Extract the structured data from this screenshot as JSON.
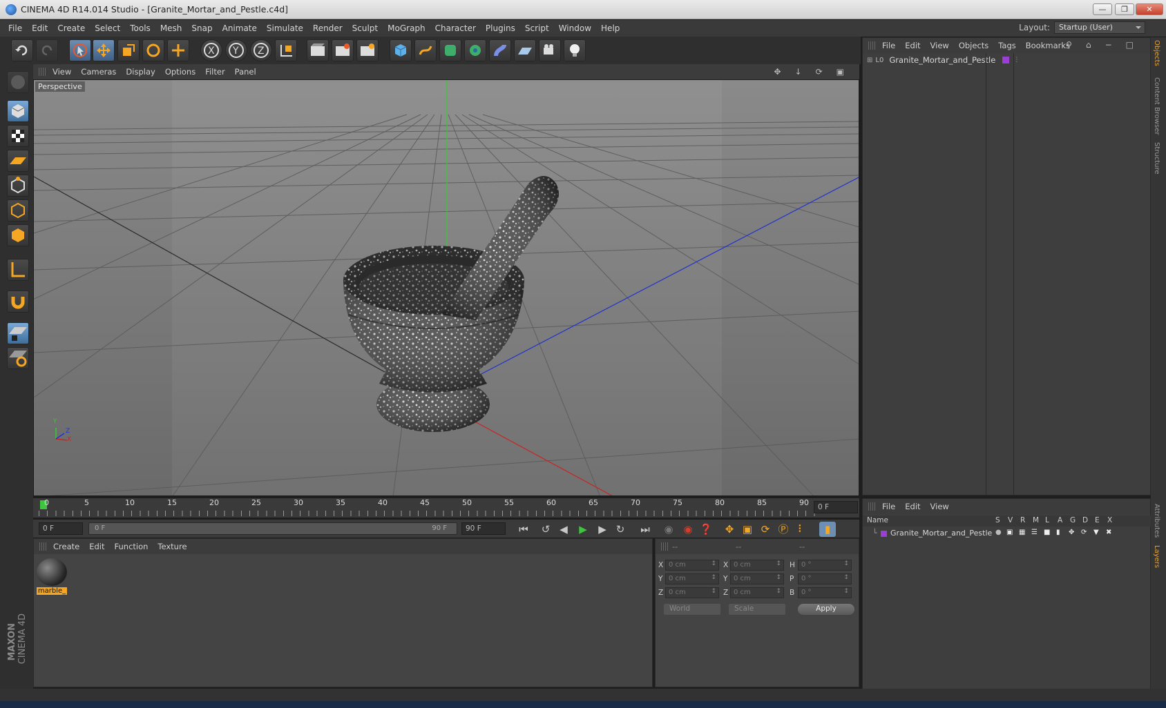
{
  "window": {
    "title": "CINEMA 4D R14.014 Studio - [Granite_Mortar_and_Pestle.c4d]"
  },
  "menubar": {
    "items": [
      "File",
      "Edit",
      "Create",
      "Select",
      "Tools",
      "Mesh",
      "Snap",
      "Animate",
      "Simulate",
      "Render",
      "Sculpt",
      "MoGraph",
      "Character",
      "Plugins",
      "Script",
      "Window",
      "Help"
    ],
    "layout_label": "Layout:",
    "layout_value": "Startup (User)"
  },
  "viewport": {
    "menu": [
      "View",
      "Cameras",
      "Display",
      "Options",
      "Filter",
      "Panel"
    ],
    "camera_label": "Perspective",
    "axis_y": "Y",
    "axis_x": "X",
    "axis_z": "Z"
  },
  "timeline": {
    "ticks": [
      "0",
      "5",
      "10",
      "15",
      "20",
      "25",
      "30",
      "35",
      "40",
      "45",
      "50",
      "55",
      "60",
      "65",
      "70",
      "75",
      "80",
      "85",
      "90"
    ],
    "current_frame": "0 F"
  },
  "transport": {
    "start_frame": "0 F",
    "range_start": "0 F",
    "range_end": "90 F",
    "end_frame": "90 F"
  },
  "material_panel": {
    "menu": [
      "Create",
      "Edit",
      "Function",
      "Texture"
    ],
    "material_name": "marble_"
  },
  "coord_panel": {
    "headers": [
      "--",
      "--",
      "--"
    ],
    "rows": [
      {
        "l1": "X",
        "v1": "0 cm",
        "l2": "X",
        "v2": "0 cm",
        "l3": "H",
        "v3": "0 °"
      },
      {
        "l1": "Y",
        "v1": "0 cm",
        "l2": "Y",
        "v2": "0 cm",
        "l3": "P",
        "v3": "0 °"
      },
      {
        "l1": "Z",
        "v1": "0 cm",
        "l2": "Z",
        "v2": "0 cm",
        "l3": "B",
        "v3": "0 °"
      }
    ],
    "world": "World",
    "scale": "Scale",
    "apply": "Apply"
  },
  "objects_panel": {
    "menu": [
      "File",
      "Edit",
      "View",
      "Objects",
      "Tags",
      "Bookmarks"
    ],
    "object_name": "Granite_Mortar_and_Pestle",
    "tag_color": "#9b3fd4"
  },
  "layers_panel": {
    "menu": [
      "File",
      "Edit",
      "View"
    ],
    "name_header": "Name",
    "flags": [
      "S",
      "V",
      "R",
      "M",
      "L",
      "A",
      "G",
      "D",
      "E",
      "X"
    ],
    "layer_name": "Granite_Mortar_and_Pestle"
  },
  "side_tabs": [
    "Objects",
    "Content Browser",
    "Structure",
    "Attributes",
    "Layers"
  ],
  "brand": {
    "line1": "MAXON",
    "line2": "CINEMA 4D"
  }
}
